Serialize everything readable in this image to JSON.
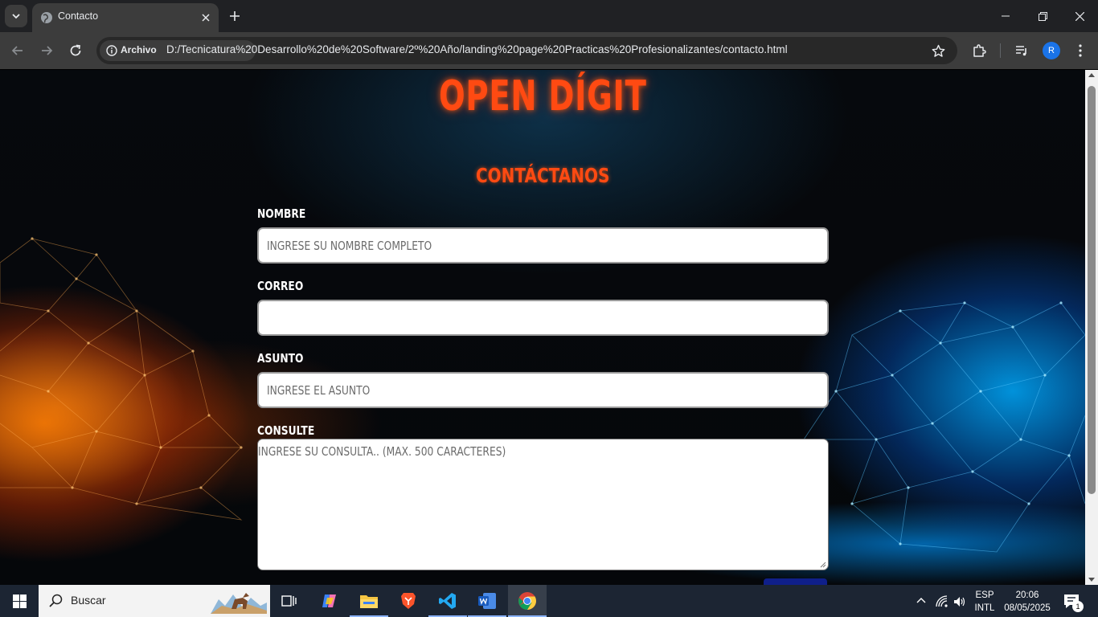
{
  "browser": {
    "tab_title": "Contacto",
    "site_chip": "Archivo",
    "url": "D:/Tecnicatura%20Desarrollo%20de%20Software/2º%20Año/landing%20page%20Practicas%20Profesionalizantes/contacto.html",
    "profile_initial": "R",
    "icons": [
      "tab-search-icon",
      "globe-icon",
      "close-icon",
      "plus-icon",
      "minimize-icon",
      "restore-icon",
      "close-window-icon",
      "back-icon",
      "forward-icon",
      "reload-icon",
      "info-icon",
      "star-icon",
      "extensions-icon",
      "media-icon",
      "menu-icon"
    ]
  },
  "page": {
    "logo": "OPEN DÍGIT",
    "heading": "CONTÁCTANOS",
    "form": {
      "name_label": "NOMBRE",
      "name_placeholder": "INGRESE SU NOMBRE COMPLETO",
      "email_label": "CORREO",
      "email_placeholder": "",
      "subject_label": "ASUNTO",
      "subject_placeholder": "INGRESE EL ASUNTO",
      "query_label": "CONSULTE",
      "query_placeholder": "INGRESE SU CONSULTA.. (MAX. 500 CARACTERES)"
    },
    "colors": {
      "accent": "#ff4a12",
      "label": "#ffffff",
      "submit": "#0f1f8a"
    }
  },
  "taskbar": {
    "search_text": "Buscar",
    "language_top": "ESP",
    "language_bottom": "INTL",
    "time": "20:06",
    "date": "08/05/2025",
    "notification_count": "1",
    "apps": [
      "task-view-icon",
      "copilot-icon",
      "file-explorer-icon",
      "brave-icon",
      "vscode-icon",
      "word-icon",
      "chrome-icon"
    ]
  }
}
